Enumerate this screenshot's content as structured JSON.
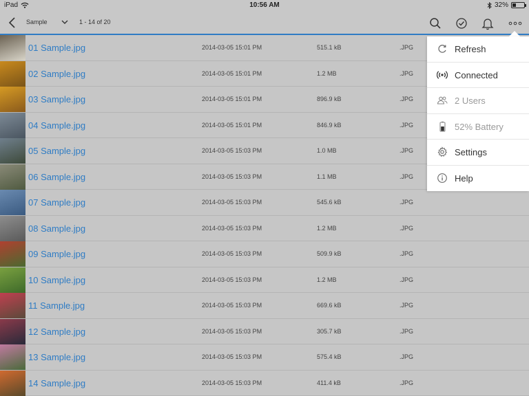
{
  "status_bar": {
    "device": "iPad",
    "time": "10:56 AM",
    "battery_text": "32%",
    "battery_level": 0.32
  },
  "toolbar": {
    "folder_name": "Sample",
    "item_count": "1 - 14 of 20"
  },
  "files": [
    {
      "name": "01 Sample.jpg",
      "date": "2014-03-05 15:01 PM",
      "size": "515.1 kB",
      "type": ".JPG",
      "thumb_colors": [
        "#6b6253",
        "#d8d4c8"
      ]
    },
    {
      "name": "02 Sample.jpg",
      "date": "2014-03-05 15:01 PM",
      "size": "1.2 MB",
      "type": ".JPG",
      "thumb_colors": [
        "#c98a1e",
        "#7a5418"
      ]
    },
    {
      "name": "03 Sample.jpg",
      "date": "2014-03-05 15:01 PM",
      "size": "896.9 kB",
      "type": ".JPG",
      "thumb_colors": [
        "#d59a24",
        "#8a5a1c"
      ]
    },
    {
      "name": "04 Sample.jpg",
      "date": "2014-03-05 15:01 PM",
      "size": "846.9 kB",
      "type": ".JPG",
      "thumb_colors": [
        "#7d8a96",
        "#4a5560"
      ]
    },
    {
      "name": "05 Sample.jpg",
      "date": "2014-03-05 15:03 PM",
      "size": "1.0 MB",
      "type": ".JPG",
      "thumb_colors": [
        "#6f7f8c",
        "#3e4a3a"
      ]
    },
    {
      "name": "06 Sample.jpg",
      "date": "2014-03-05 15:03 PM",
      "size": "1.1 MB",
      "type": ".JPG",
      "thumb_colors": [
        "#8a8a78",
        "#4f5a40"
      ]
    },
    {
      "name": "07 Sample.jpg",
      "date": "2014-03-05 15:03 PM",
      "size": "545.6 kB",
      "type": ".JPG",
      "thumb_colors": [
        "#6a8ab0",
        "#3a5a80"
      ]
    },
    {
      "name": "08 Sample.jpg",
      "date": "2014-03-05 15:03 PM",
      "size": "1.2 MB",
      "type": ".JPG",
      "thumb_colors": [
        "#8d8d8d",
        "#5a5a5a"
      ]
    },
    {
      "name": "09 Sample.jpg",
      "date": "2014-03-05 15:03 PM",
      "size": "509.9 kB",
      "type": ".JPG",
      "thumb_colors": [
        "#b04030",
        "#4a6a30"
      ]
    },
    {
      "name": "10 Sample.jpg",
      "date": "2014-03-05 15:03 PM",
      "size": "1.2 MB",
      "type": ".JPG",
      "thumb_colors": [
        "#7aa040",
        "#3e6a2a"
      ]
    },
    {
      "name": "11 Sample.jpg",
      "date": "2014-03-05 15:03 PM",
      "size": "669.6 kB",
      "type": ".JPG",
      "thumb_colors": [
        "#c04050",
        "#5a4a3a"
      ]
    },
    {
      "name": "12 Sample.jpg",
      "date": "2014-03-05 15:03 PM",
      "size": "305.7 kB",
      "type": ".JPG",
      "thumb_colors": [
        "#8a3a4a",
        "#2a2a3a"
      ]
    },
    {
      "name": "13 Sample.jpg",
      "date": "2014-03-05 15:03 PM",
      "size": "575.4 kB",
      "type": ".JPG",
      "thumb_colors": [
        "#c07aa0",
        "#4a6a3a"
      ]
    },
    {
      "name": "14 Sample.jpg",
      "date": "2014-03-05 15:03 PM",
      "size": "411.4 kB",
      "type": ".JPG",
      "thumb_colors": [
        "#d06a30",
        "#5a4a2a"
      ]
    }
  ],
  "menu": [
    {
      "label": "Refresh",
      "icon": "refresh-icon",
      "dim": false
    },
    {
      "label": "Connected",
      "icon": "broadcast-icon",
      "dim": false
    },
    {
      "label": "2 Users",
      "icon": "users-icon",
      "dim": true
    },
    {
      "label": "52% Battery",
      "icon": "battery-icon",
      "dim": true,
      "battery_level": 0.52
    },
    {
      "label": "Settings",
      "icon": "gear-icon",
      "dim": false
    },
    {
      "label": "Help",
      "icon": "info-icon",
      "dim": false
    }
  ],
  "colors": {
    "accent": "#2f7cc4",
    "list_bg": "#c6c6c6",
    "menu_bg": "#ffffff"
  }
}
